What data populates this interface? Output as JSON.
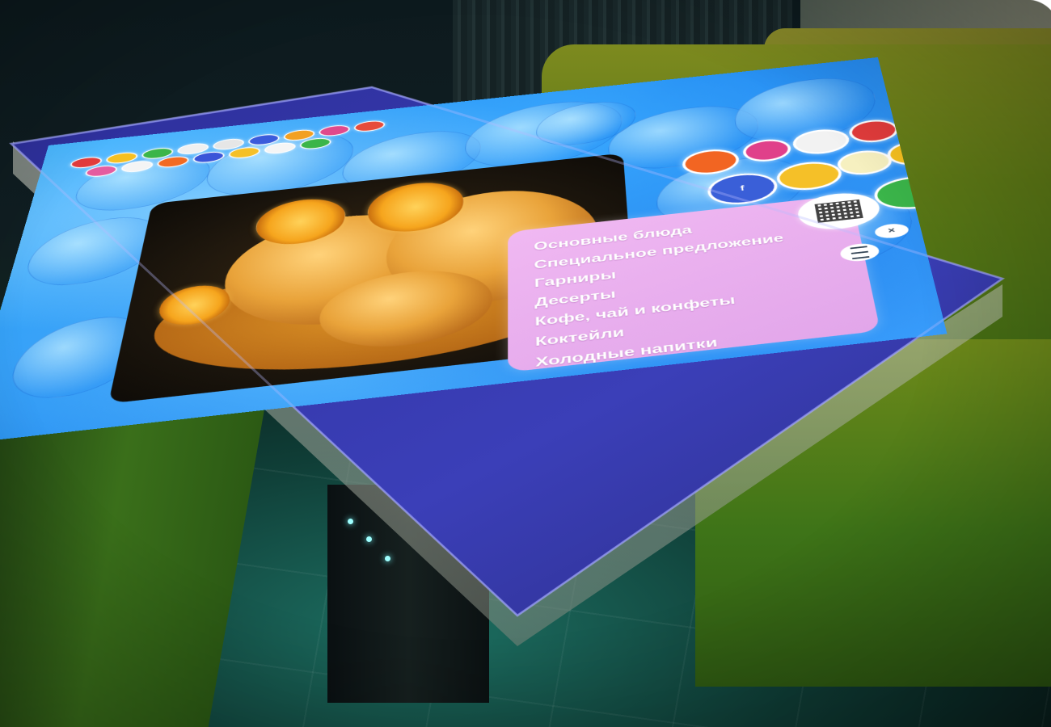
{
  "photo": {
    "subject": "",
    "menu": {
      "items": [
        "Основные блюда",
        "Специальное предложение",
        "Гарниры",
        "Десерты",
        "Кофе, чай и конфеты",
        "Коктейли",
        "Холодные напитки"
      ]
    },
    "colors": {
      "screen": "#2f9ef5",
      "menu_panel": "#e7acec",
      "bezel": "#3b3fb0",
      "sofa": "#5e7a16"
    },
    "icons": {
      "close": "close-icon",
      "menu": "hamburger-icon",
      "qr": "qr-code-icon",
      "facebook": "facebook-icon"
    }
  }
}
